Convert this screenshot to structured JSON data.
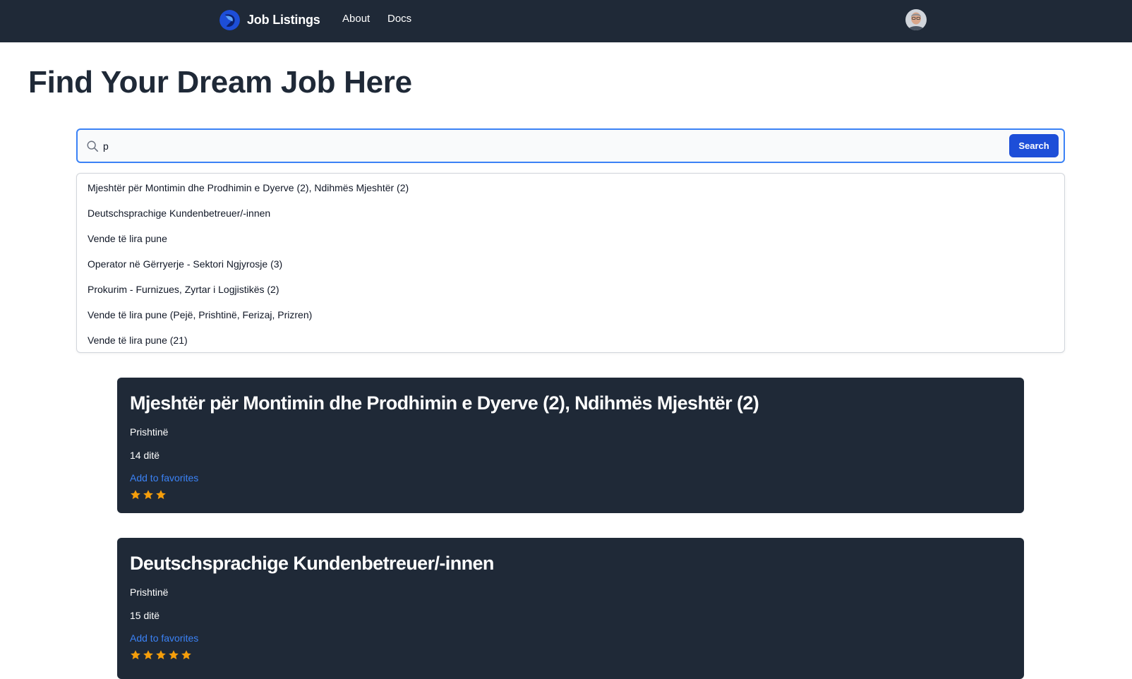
{
  "nav": {
    "brand": "Job Listings",
    "links": [
      "About",
      "Docs"
    ]
  },
  "page": {
    "title": "Find Your Dream Job Here"
  },
  "search": {
    "value": "p",
    "button_label": "Search"
  },
  "suggestions": [
    "Mjeshtër për Montimin dhe Prodhimin e Dyerve (2), Ndihmës Mjeshtër (2)",
    "Deutschsprachige Kundenbetreuer/-innen",
    "Vende të lira pune",
    "Operator në Gërryerje - Sektori Ngjyrosje (3)",
    "Prokurim - Furnizues, Zyrtar i Logjistikës (2)",
    "Vende të lira pune (Pejë, Prishtinë, Ferizaj, Prizren)",
    "Vende të lira pune (21)"
  ],
  "jobs": [
    {
      "title": "Mjeshtër për Montimin dhe Prodhimin e Dyerve (2), Ndihmës Mjeshtër (2)",
      "location": "Prishtinë",
      "age": "14 ditë",
      "favorite_label": "Add to favorites",
      "rating": 3
    },
    {
      "title": "Deutschsprachige Kundenbetreuer/-innen",
      "location": "Prishtinë",
      "age": "15 ditë",
      "favorite_label": "Add to favorites",
      "rating": 5
    }
  ],
  "colors": {
    "navbar": "#1f2937",
    "accent": "#1d4ed8",
    "link": "#3b82f6",
    "star": "#f59e0b"
  },
  "icons": {
    "logo": "brand-logo-icon",
    "search": "search-icon",
    "star": "star-icon"
  }
}
